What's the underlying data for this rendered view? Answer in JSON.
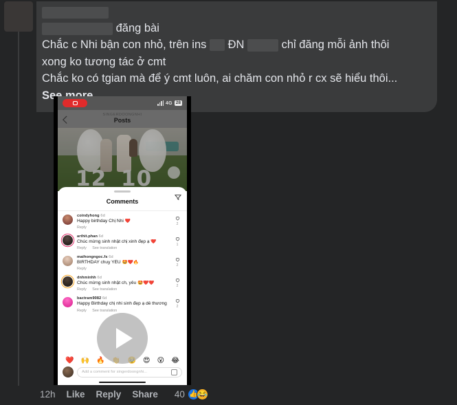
{
  "post": {
    "author_redacted_1": "",
    "author_redacted_2": "",
    "byline_suffix": "đăng bài",
    "lines": [
      {
        "pre": "Chắc c Nhi bận con nhỏ, trên ins ",
        "mid": " ĐN ",
        "post": " chỉ đăng mỗi ảnh thôi"
      },
      {
        "text": "xong ko tương tác ở cmt"
      },
      {
        "text": "Chắc ko có tgian mà để ý cmt luôn, ai chăm con nhỏ r cx sẽ hiểu thôi..."
      }
    ],
    "see_more": "See more"
  },
  "video": {
    "status_bar": {
      "recording_icon": "camera-record-icon",
      "signal_icon": "signal-bars-icon",
      "network": "4G",
      "battery": "28"
    },
    "instagram": {
      "back_icon": "chevron-left-icon",
      "handle": "SINGERDOONGNHI",
      "title": "Posts",
      "photo_numbers_left": "12",
      "photo_numbers_right": "10"
    },
    "sheet": {
      "title": "Comments",
      "share_icon": "share-icon",
      "comments": [
        {
          "username": "coindyhong",
          "time": "6d",
          "text": "Happy birthday Chị Nhi ❤️",
          "reply": "Reply",
          "translate": "",
          "likes": "2"
        },
        {
          "username": "arthit.phan",
          "time": "6d",
          "text": "Chúc mừng sinh nhật chị xinh đẹp ạ ❤️",
          "reply": "Reply",
          "translate": "See translation",
          "likes": "1"
        },
        {
          "username": "maihongngoc.fs",
          "time": "6d",
          "text": "BIRTHDAY chuỵ YÊU 🤩❤️🔥",
          "reply": "Reply",
          "translate": "",
          "likes": "2"
        },
        {
          "username": "dnhminhh",
          "time": "6d",
          "text": "Chúc mừng sinh nhật ch, yêu 🤩❤️❤️",
          "reply": "Reply",
          "translate": "See translation",
          "likes": "2"
        },
        {
          "username": "bactram9082",
          "time": "6d",
          "text": "Happy Birthday chị nhi sinh đẹp ạ dễ thương",
          "reply": "Reply",
          "translate": "See translation",
          "likes": "2"
        }
      ],
      "quick_emojis": [
        "❤️",
        "🙌",
        "🔥",
        "👏",
        "🥹",
        "😍",
        "😮",
        "😂"
      ],
      "input_placeholder": "Add a comment for singerdoongnhi...",
      "sticker_icon": "sticker-icon",
      "my_avatar": "avatar"
    },
    "play_icon": "play-icon"
  },
  "footer": {
    "timestamp": "12h",
    "like": "Like",
    "reply": "Reply",
    "share": "Share",
    "reaction_count": "40",
    "reaction_like_icon": "thumbs-up-icon",
    "reaction_haha_icon": "haha-emoji-icon"
  },
  "colors": {
    "page_bg": "#242526",
    "bubble_bg": "#3a3b3c",
    "text": "#e4e6eb",
    "muted": "#b0b3b8",
    "accent_blue": "#1b74e4",
    "accent_yellow": "#f7b125"
  }
}
